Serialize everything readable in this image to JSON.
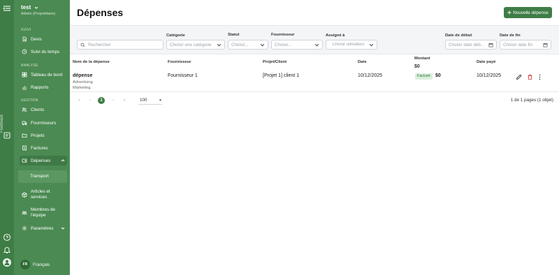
{
  "workspace": {
    "name": "test",
    "role": "Admin (Propriétaire)"
  },
  "sidebar": {
    "sections": {
      "suivi": "SUIVI",
      "analyse": "ANALYSE",
      "gestion": "GESTION"
    },
    "items": [
      {
        "label": "Devis",
        "icon": "document-icon"
      },
      {
        "label": "Suivi du temps",
        "icon": "clock-icon"
      },
      {
        "label": "Tableau de bord",
        "icon": "dashboard-icon"
      },
      {
        "label": "Rapports",
        "icon": "chart-icon"
      },
      {
        "label": "Clients",
        "icon": "users-icon"
      },
      {
        "label": "Fournisseurs",
        "icon": "truck-icon"
      },
      {
        "label": "Projets",
        "icon": "folder-icon"
      },
      {
        "label": "Factures",
        "icon": "invoice-icon"
      },
      {
        "label": "Dépenses",
        "icon": "wallet-icon"
      },
      {
        "label": "Articles et services",
        "icon": "box-icon"
      },
      {
        "label": "Membres de l'équipe",
        "icon": "team-icon"
      },
      {
        "label": "Paramètres",
        "icon": "gear-icon"
      }
    ],
    "sub_items": [
      {
        "label": "Transport"
      }
    ],
    "language": {
      "flag": "FR",
      "label": "Français"
    },
    "feedback_label": "Feedback"
  },
  "page": {
    "title": "Dépenses",
    "new_button": "Nouvelle dépense"
  },
  "filters": {
    "search_placeholder": "Rechercher",
    "category": {
      "label": "Catégorie",
      "placeholder": "Choisir une catégorie"
    },
    "status": {
      "label": "Statut",
      "placeholder": "Choisir..."
    },
    "supplier": {
      "label": "Fournisseur",
      "placeholder": "Choisir..."
    },
    "assigned": {
      "label": "Assigné à",
      "placeholder": "Choisir utilisateur"
    },
    "start_date": {
      "label": "Date de début",
      "placeholder": "Choisir date déb..."
    },
    "end_date": {
      "label": "Date de fin",
      "placeholder": "Choisir date fin"
    }
  },
  "table": {
    "columns": {
      "name": "Nom de la dépense",
      "supplier": "Fournisseur",
      "project": "Projet/Client",
      "date": "Date",
      "amount": "Montant",
      "amount_total": "$0",
      "paid_date": "Date payé"
    },
    "rows": [
      {
        "name": "dépense",
        "tags": [
          "Advertising",
          "Marketing"
        ],
        "supplier": "Fournisseur 1",
        "project": "[Projet 1] client 1",
        "date": "10/12/2025",
        "status": "Facturé",
        "amount": "$0",
        "paid_date": "10/12/2025"
      }
    ]
  },
  "pagination": {
    "current_page": "1",
    "per_page": "100",
    "info": "1 de 1 pages (1 objet)"
  },
  "colors": {
    "brand": "#3f7d46",
    "sidebar": "#4b8a52",
    "badge_bg": "#d9f0dc",
    "delete": "#d63b3b"
  }
}
